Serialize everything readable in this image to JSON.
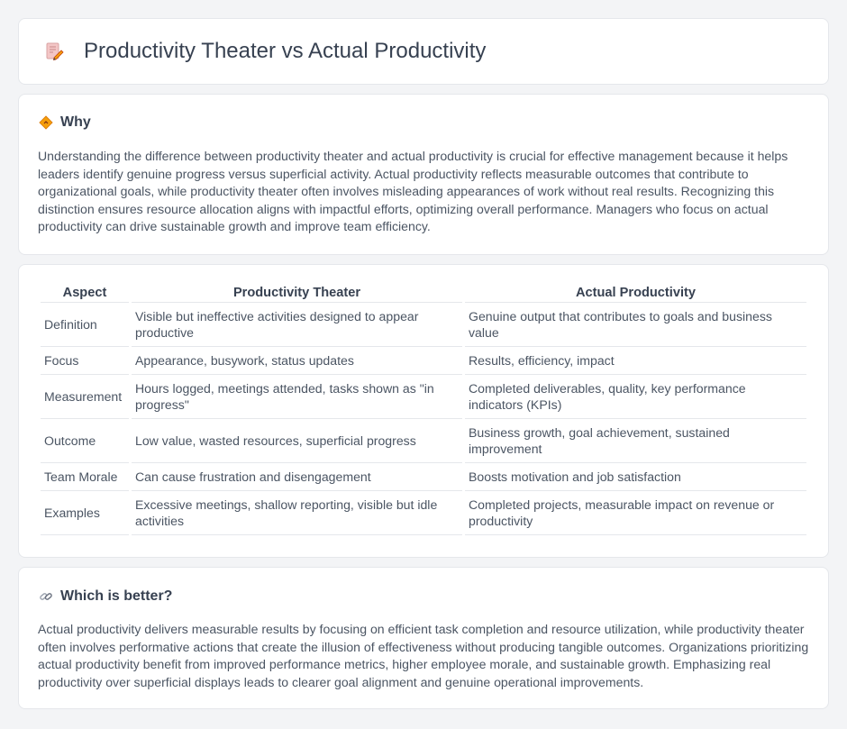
{
  "header": {
    "title": "Productivity Theater vs Actual Productivity",
    "icon": "document-pencil-icon"
  },
  "why": {
    "heading": "Why",
    "icon": "diamond-sign-icon",
    "text": "Understanding the difference between productivity theater and actual productivity is crucial for effective management because it helps leaders identify genuine progress versus superficial activity. Actual productivity reflects measurable outcomes that contribute to organizational goals, while productivity theater often involves misleading appearances of work without real results. Recognizing this distinction ensures resource allocation aligns with impactful efforts, optimizing overall performance. Managers who focus on actual productivity can drive sustainable growth and improve team efficiency."
  },
  "table": {
    "headers": [
      "Aspect",
      "Productivity Theater",
      "Actual Productivity"
    ],
    "rows": [
      [
        "Definition",
        "Visible but ineffective activities designed to appear productive",
        "Genuine output that contributes to goals and business value"
      ],
      [
        "Focus",
        "Appearance, busywork, status updates",
        "Results, efficiency, impact"
      ],
      [
        "Measurement",
        "Hours logged, meetings attended, tasks shown as \"in progress\"",
        "Completed deliverables, quality, key performance indicators (KPIs)"
      ],
      [
        "Outcome",
        "Low value, wasted resources, superficial progress",
        "Business growth, goal achievement, sustained improvement"
      ],
      [
        "Team Morale",
        "Can cause frustration and disengagement",
        "Boosts motivation and job satisfaction"
      ],
      [
        "Examples",
        "Excessive meetings, shallow reporting, visible but idle activities",
        "Completed projects, measurable impact on revenue or productivity"
      ]
    ]
  },
  "better": {
    "heading": "Which is better?",
    "icon": "link-icon",
    "text": "Actual productivity delivers measurable results by focusing on efficient task completion and resource utilization, while productivity theater often involves performative actions that create the illusion of effectiveness without producing tangible outcomes. Organizations prioritizing actual productivity benefit from improved performance metrics, higher employee morale, and sustainable growth. Emphasizing real productivity over superficial displays leads to clearer goal alignment and genuine operational improvements."
  }
}
